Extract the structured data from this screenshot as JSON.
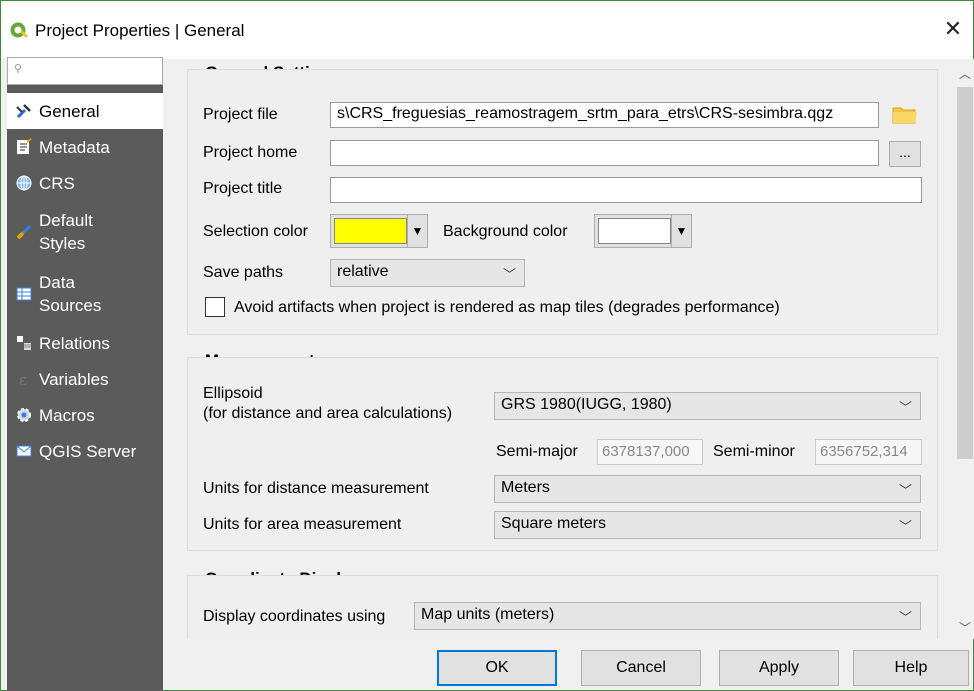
{
  "window": {
    "title": "Project Properties | General",
    "close_glyph": "✕"
  },
  "sidebar": {
    "search_placeholder": "",
    "items": [
      {
        "label": "General",
        "icon": "wrench-icon"
      },
      {
        "label": "Metadata",
        "icon": "metadata-icon"
      },
      {
        "label": "CRS",
        "icon": "globe-icon"
      },
      {
        "label": "Default\nStyles",
        "icon": "brush-icon"
      },
      {
        "label": "Data\nSources",
        "icon": "table-icon"
      },
      {
        "label": "Relations",
        "icon": "relations-icon"
      },
      {
        "label": "Variables",
        "icon": "variables-icon"
      },
      {
        "label": "Macros",
        "icon": "gear-icon"
      },
      {
        "label": "QGIS Server",
        "icon": "server-icon"
      }
    ]
  },
  "general_settings": {
    "header": "General Settings",
    "project_file_label": "Project file",
    "project_file_value": "s\\CRS_freguesias_reamostragem_srtm_para_etrs\\CRS-sesimbra.qgz",
    "project_home_label": "Project home",
    "project_home_value": "",
    "browse_label": "...",
    "project_title_label": "Project title",
    "project_title_value": "",
    "selection_color_label": "Selection color",
    "selection_color": "#ffff00",
    "background_color_label": "Background color",
    "background_color": "#ffffff",
    "save_paths_label": "Save paths",
    "save_paths_value": "relative",
    "avoid_artifacts_label": "Avoid artifacts when project is rendered as map tiles (degrades performance)"
  },
  "measurements": {
    "header": "Measurements",
    "ellipsoid_label_line1": "Ellipsoid",
    "ellipsoid_label_line2": "(for distance and area calculations)",
    "ellipsoid_value": "GRS 1980(IUGG, 1980)",
    "semi_major_label": "Semi-major",
    "semi_major_value": "6378137,000",
    "semi_minor_label": "Semi-minor",
    "semi_minor_value": "6356752,314",
    "distance_units_label": "Units for distance measurement",
    "distance_units_value": "Meters",
    "area_units_label": "Units for area measurement",
    "area_units_value": "Square meters"
  },
  "coordinate_display": {
    "header": "Coordinate Display",
    "display_label": "Display coordinates using",
    "display_value": "Map units (meters)"
  },
  "buttons": {
    "ok": "OK",
    "cancel": "Cancel",
    "apply": "Apply",
    "help": "Help"
  },
  "colors": {
    "sidebar_bg": "#5b5b5b",
    "window_border": "#3c8a3c",
    "default_button_border": "#0078d7"
  }
}
